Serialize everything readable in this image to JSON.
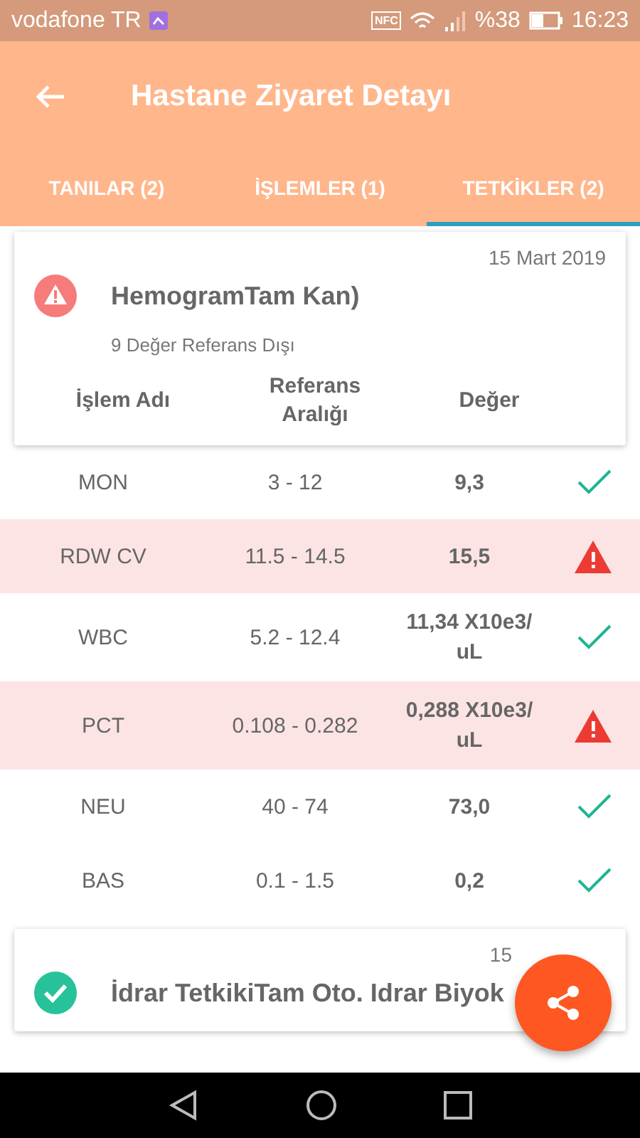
{
  "status_bar": {
    "carrier": "vodafone TR",
    "nfc": "NFC",
    "battery": "%38",
    "time": "16:23"
  },
  "app_bar": {
    "title": "Hastane Ziyaret Detayı"
  },
  "tabs": [
    {
      "label": "TANILAR (2)",
      "selected": false
    },
    {
      "label": "İŞLEMLER (1)",
      "selected": false
    },
    {
      "label": "TETKİKLER (2)",
      "selected": true
    }
  ],
  "tests": [
    {
      "date": "15 Mart 2019",
      "title": "HemogramTam Kan)",
      "alert": true,
      "subtitle": "9 Değer Referans Dışı",
      "columns": [
        "İşlem Adı",
        "Referans Aralığı",
        "Değer"
      ],
      "rows": [
        {
          "name": "MON",
          "range": "3 - 12",
          "value": "9,3",
          "out_of_range": false
        },
        {
          "name": "RDW CV",
          "range": "11.5 - 14.5",
          "value": "15,5",
          "out_of_range": true
        },
        {
          "name": "WBC",
          "range": "5.2 - 12.4",
          "value": "11,34 X10e3/ uL",
          "out_of_range": false
        },
        {
          "name": "PCT",
          "range": "0.108 - 0.282",
          "value": "0,288 X10e3/ uL",
          "out_of_range": true
        },
        {
          "name": "NEU",
          "range": "40 - 74",
          "value": "73,0",
          "out_of_range": false
        },
        {
          "name": "BAS",
          "range": "0.1 - 1.5",
          "value": "0,2",
          "out_of_range": false
        }
      ]
    },
    {
      "date": "15",
      "title": "İdrar TetkikiTam Oto. Idrar Biyok",
      "alert": false
    }
  ]
}
